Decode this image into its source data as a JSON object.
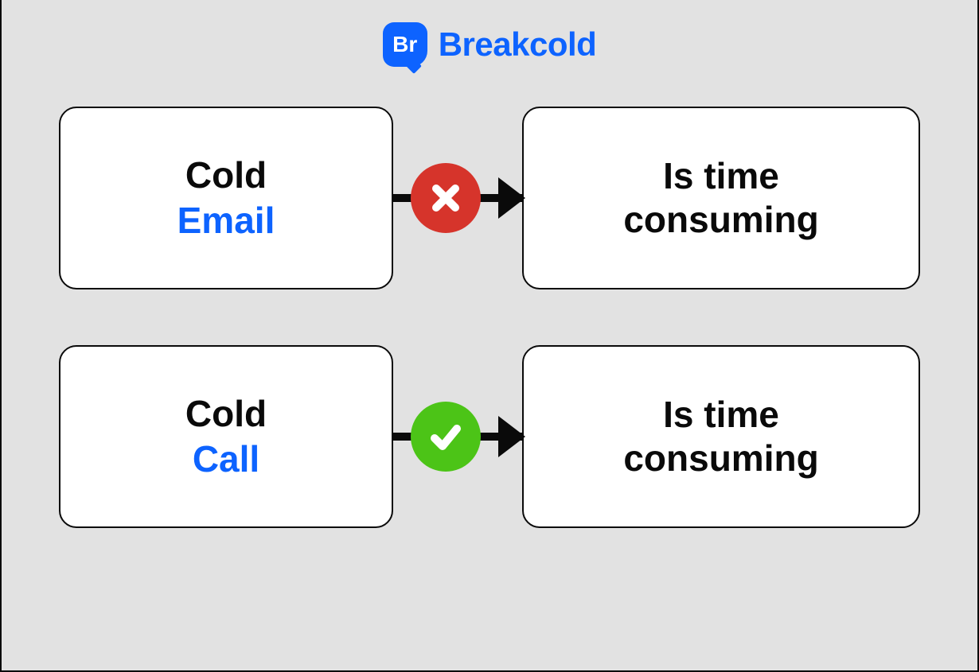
{
  "brand": {
    "badge_text": "Br",
    "name": "Breakcold"
  },
  "rows": [
    {
      "left_title": "Cold",
      "left_sub": "Email",
      "status": "cross",
      "right_text_line1": "Is time",
      "right_text_line2": "consuming"
    },
    {
      "left_title": "Cold",
      "left_sub": "Call",
      "status": "check",
      "right_text_line1": "Is time",
      "right_text_line2": "consuming"
    }
  ],
  "colors": {
    "accent": "#0d63ff",
    "cross": "#d6342b",
    "check": "#4cc417"
  }
}
